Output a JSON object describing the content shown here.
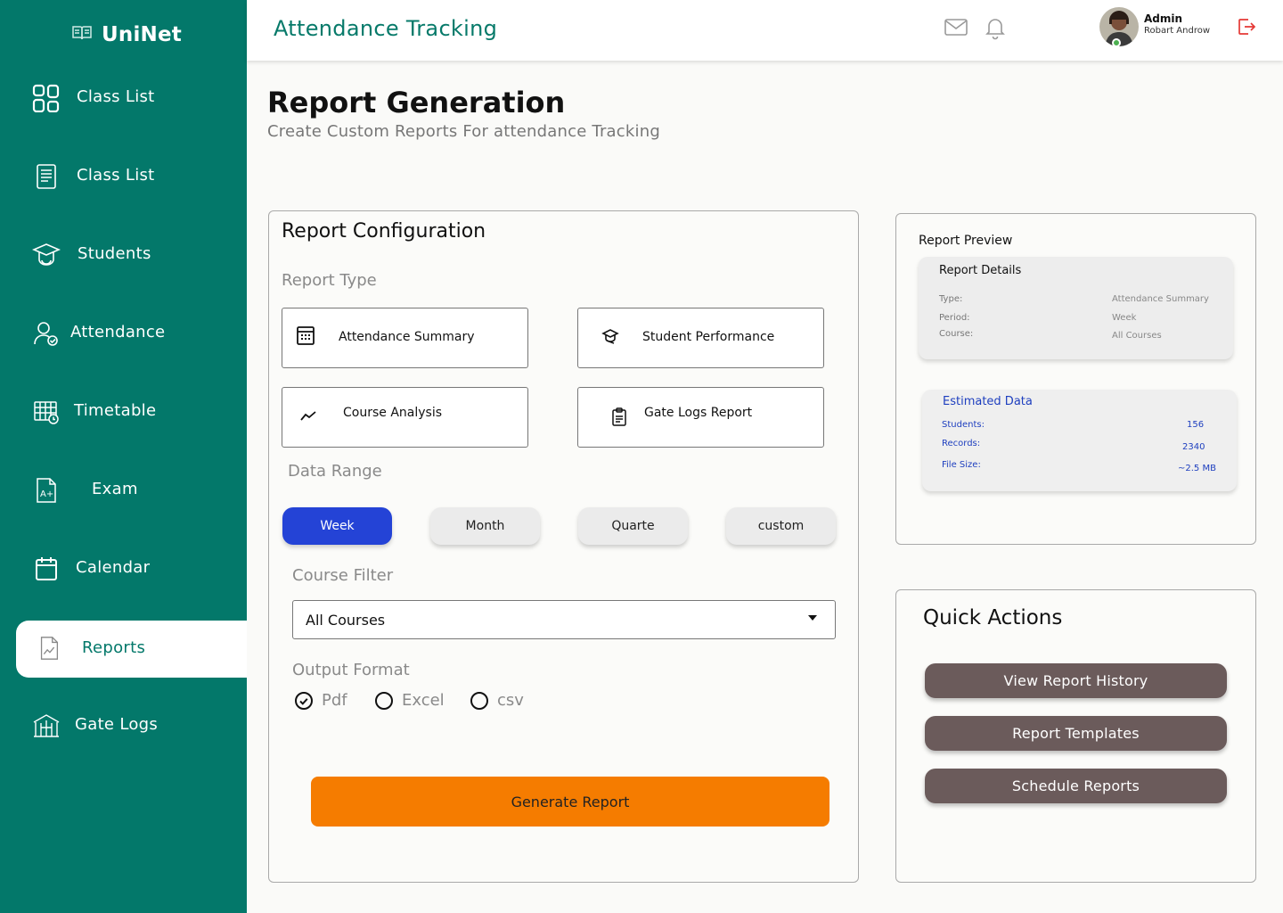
{
  "brand": {
    "name": "UniNet",
    "icon": "book-icon"
  },
  "sidebar": {
    "items": [
      {
        "label": "Class List",
        "icon": "grid-icon"
      },
      {
        "label": "Class List",
        "icon": "document-list-icon"
      },
      {
        "label": "Students",
        "icon": "graduate-cap-icon"
      },
      {
        "label": "Attendance",
        "icon": "user-check-icon"
      },
      {
        "label": "Timetable",
        "icon": "table-clock-icon"
      },
      {
        "label": "Exam",
        "icon": "grade-file-icon"
      },
      {
        "label": "Calendar",
        "icon": "calendar-icon"
      },
      {
        "label": "Reports",
        "icon": "chart-file-icon",
        "active": true
      },
      {
        "label": "Gate Logs",
        "icon": "gate-icon"
      }
    ]
  },
  "header": {
    "title": "Attendance Tracking",
    "icons": [
      "mail-icon",
      "bell-icon",
      "logout-icon"
    ],
    "user": {
      "role": "Admin",
      "name": "Robart Androw",
      "status": "online"
    }
  },
  "page": {
    "title": "Report Generation",
    "subtitle": "Create Custom Reports For attendance Tracking"
  },
  "config": {
    "title": "Report Configuration",
    "report_type_label": "Report Type",
    "report_types": [
      {
        "label": "Attendance Summary",
        "icon": "calendar-grid-icon"
      },
      {
        "label": "Student Performance",
        "icon": "graduate-cap-icon"
      },
      {
        "label": "Course Analysis",
        "icon": "trend-line-icon"
      },
      {
        "label": "Gate Logs Report",
        "icon": "clipboard-icon"
      }
    ],
    "data_range_label": "Data Range",
    "ranges": [
      {
        "label": "Week",
        "active": true
      },
      {
        "label": "Month"
      },
      {
        "label": "Quarte"
      },
      {
        "label": "custom"
      }
    ],
    "course_filter_label": "Course Filter",
    "course_filter_value": "All Courses",
    "output_format_label": "Output Format",
    "formats": [
      {
        "label": "Pdf",
        "checked": true
      },
      {
        "label": "Excel",
        "checked": false
      },
      {
        "label": "csv",
        "checked": false
      }
    ],
    "generate_label": "Generate Report"
  },
  "preview": {
    "title": "Report Preview",
    "details_title": "Report Details",
    "details": [
      {
        "key": "Type:",
        "value": "Attendance Summary"
      },
      {
        "key": "Period:",
        "value": "Week"
      },
      {
        "key": "Course:",
        "value": "All Courses"
      }
    ],
    "estimated_title": "Estimated Data",
    "estimated": [
      {
        "key": "Students:",
        "value": "156"
      },
      {
        "key": "Records:",
        "value": "2340"
      },
      {
        "key": "File Size:",
        "value": "~2.5 MB"
      }
    ]
  },
  "quick_actions": {
    "title": "Quick Actions",
    "buttons": [
      "View Report History",
      "Report Templates",
      "Schedule Reports"
    ]
  },
  "colors": {
    "sidebar": "#03786a",
    "accent_blue": "#2443d6",
    "generate": "#f57c00",
    "quick_action": "#6b5b5b"
  }
}
